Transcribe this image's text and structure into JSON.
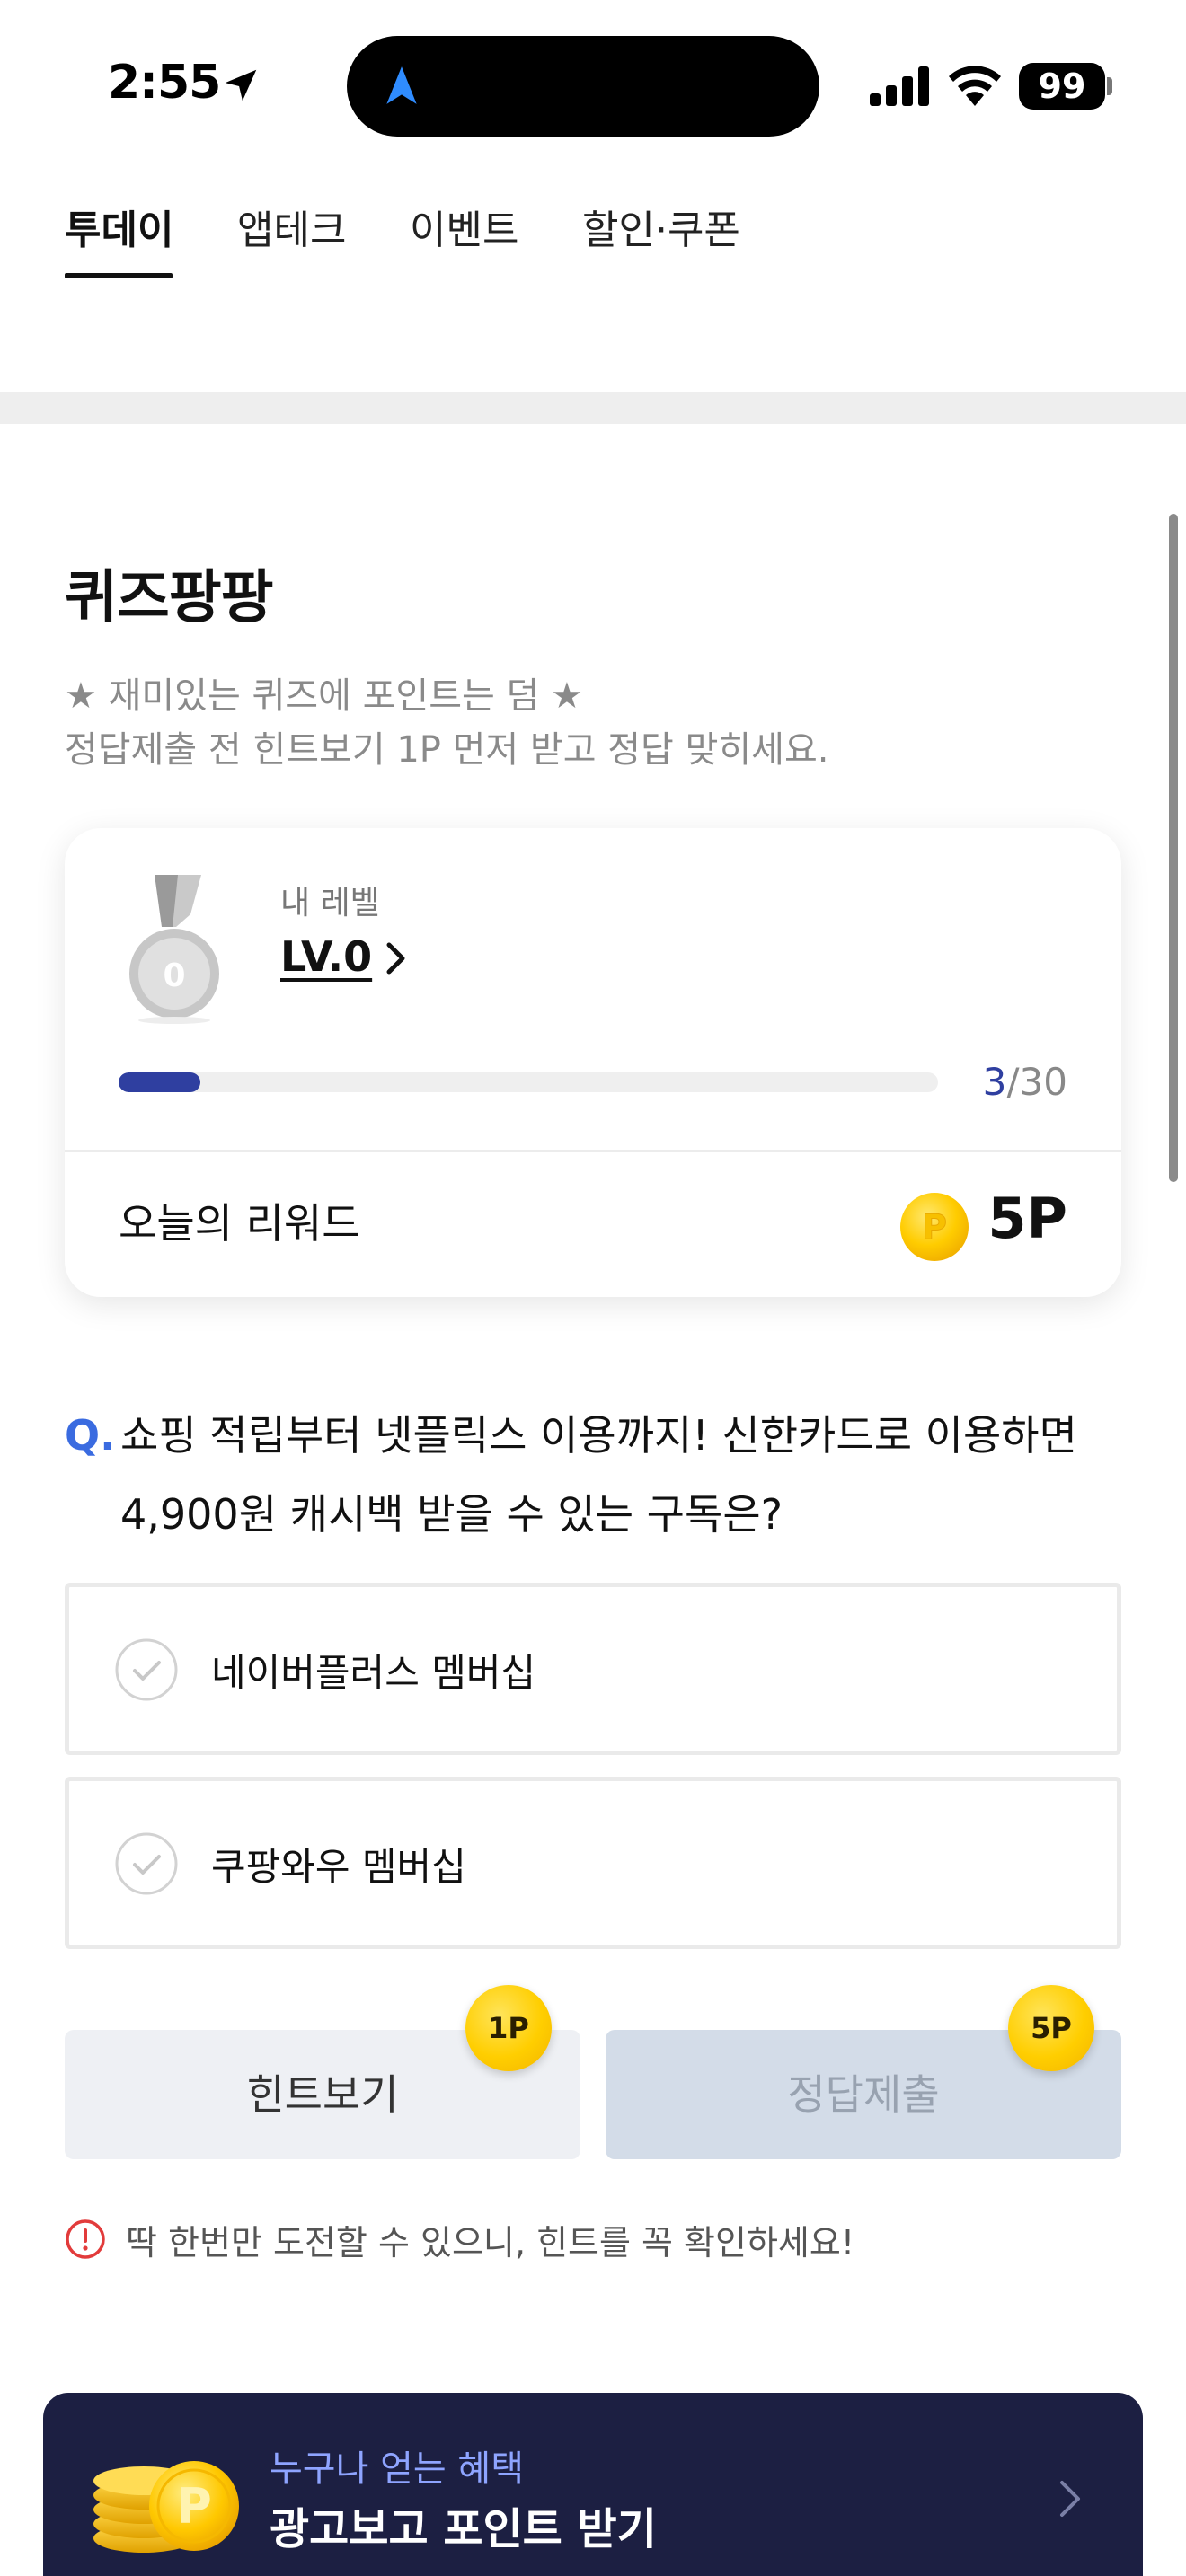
{
  "status_bar": {
    "time": "2:55",
    "battery": "99",
    "location_icon": "location-arrow-icon",
    "nav_icon": "navigation-arrow-icon",
    "signal_icon": "cellular-signal-icon",
    "wifi_icon": "wifi-icon"
  },
  "tabs": [
    {
      "label": "투데이",
      "active": true
    },
    {
      "label": "앱테크",
      "active": false
    },
    {
      "label": "이벤트",
      "active": false
    },
    {
      "label": "할인·쿠폰",
      "active": false
    }
  ],
  "section": {
    "title": "퀴즈팡팡",
    "desc_line1": "★ 재미있는 퀴즈에 포인트는 덤 ★",
    "desc_line2": "정답제출 전 힌트보기 1P 먼저 받고 정답 맞히세요."
  },
  "level_card": {
    "caption": "내 레벨",
    "level": "LV.0",
    "medal_number": "0",
    "progress_current": "3",
    "progress_total": "/30",
    "progress_fraction": 0.1,
    "reward_label": "오늘의 리워드",
    "reward_value": "5P",
    "coin_letter": "P"
  },
  "quiz": {
    "q_mark": "Q.",
    "question": "쇼핑 적립부터 넷플릭스 이용까지! 신한카드로 이용하면 4,900원 캐시백 받을 수 있는 구독은?",
    "options": [
      {
        "label": "네이버플러스 멤버십"
      },
      {
        "label": "쿠팡와우 멤버십"
      }
    ]
  },
  "buttons": {
    "hint_label": "힌트보기",
    "hint_badge": "1P",
    "submit_label": "정답제출",
    "submit_badge": "5P"
  },
  "warning": {
    "text": "딱 한번만 도전할 수 있으니, 힌트를 꼭 확인하세요!"
  },
  "banner": {
    "subtitle": "누구나 얻는 혜택",
    "title": "광고보고 포인트 받기",
    "coin_letter": "P"
  },
  "colors": {
    "accent_blue": "#2f3fa0",
    "question_blue": "#3a6be0",
    "coin_gold": "#ffce00",
    "banner_bg": "#1c1f42"
  }
}
